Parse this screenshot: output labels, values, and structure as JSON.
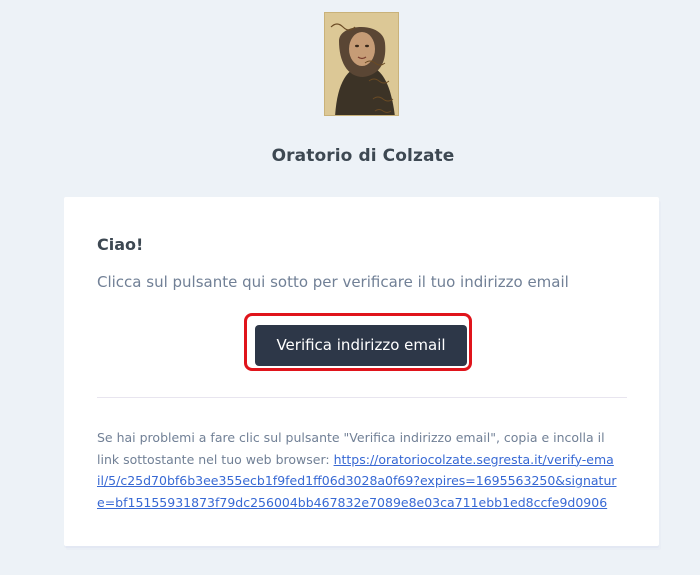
{
  "header": {
    "logo_label": "Oratorio Beata Chiara Badano Colzate logo",
    "site_name": "Oratorio di Colzate"
  },
  "card": {
    "greeting": "Ciao!",
    "intro": "Clicca sul pulsante qui sotto per verificare il tuo indirizzo email",
    "button_label": "Verifica indirizzo email",
    "subcopy": {
      "line1": "Se hai problemi a fare clic sul pulsante \"Verifica indirizzo email\", copia e incolla il",
      "line2_prefix": "link sottostante nel tuo web browser: ",
      "link_line1": "https://oratoriocolzate.segresta.it/verify-ema",
      "link_line2": "il/5/c25d70bf6b3ee355ecb1f9fed1ff06d3028a0f69?expires=1695563250&signatur",
      "link_line3": "e=bf15155931873f79dc256004bb467832e7089e8e03ca711ebb1ed8ccfe9d0906",
      "url": "https://oratoriocolzate.segresta.it/verify-email/5/c25d70bf6b3ee355ecb1f9fed1ff06d3028a0f69?expires=1695563250&signature=bf15155931873f79dc256004bb467832e7089e8e03ca711ebb1ed8ccfe9d0906"
    }
  },
  "colors": {
    "background": "#edf2f7",
    "card": "#ffffff",
    "button": "#2d3748",
    "highlight": "#e0141b",
    "link": "#3869d4",
    "text": "#3d4852",
    "muted": "#718096"
  }
}
